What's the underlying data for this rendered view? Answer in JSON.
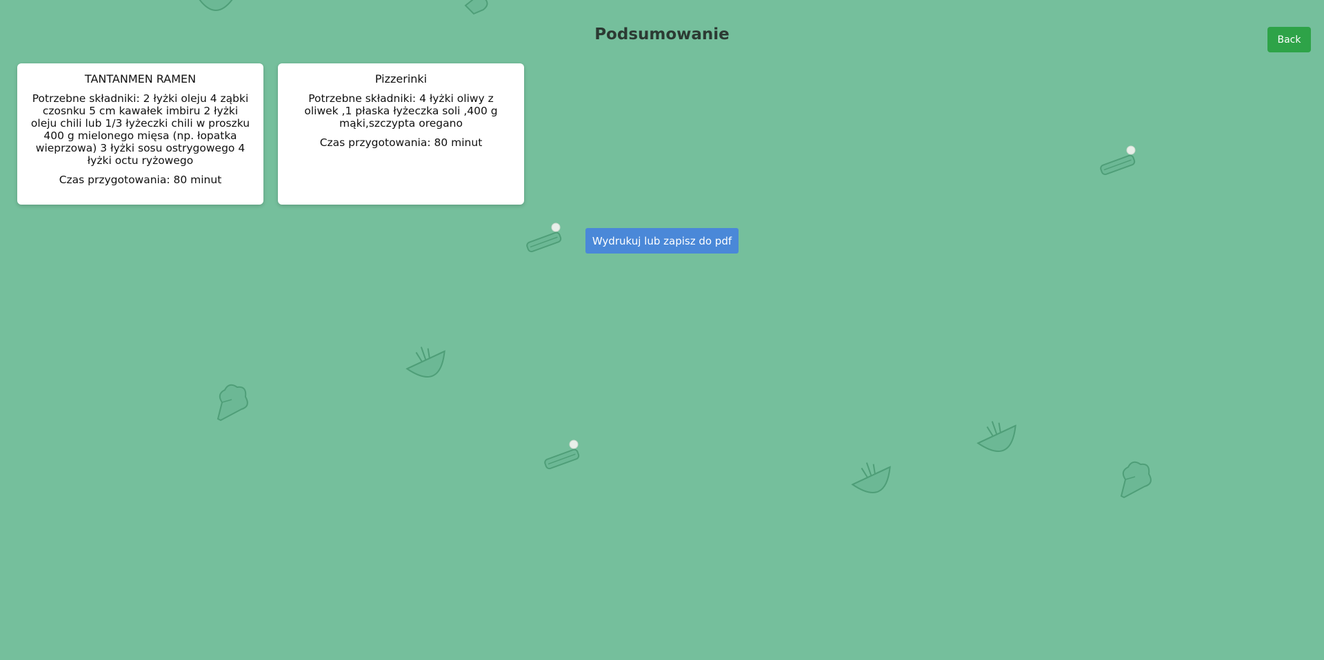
{
  "header": {
    "title": "Podsumowanie",
    "back_label": "Back"
  },
  "recipes": [
    {
      "name": "TANTANMEN RAMEN",
      "ingredients": "Potrzebne składniki: 2 łyżki oleju 4 ząbki czosnku 5 cm kawałek imbiru 2 łyżki oleju chili lub 1/3 łyżeczki chili w proszku 400 g mielonego mięsa (np. łopatka wieprzowa) 3 łyżki sosu ostrygowego 4 łyżki octu ryżowego",
      "time": "Czas przygotowania: 80 minut"
    },
    {
      "name": "Pizzerinki",
      "ingredients": "Potrzebne składniki: 4 łyżki oliwy z oliwek ,1 płaska łyżeczka soli ,400 g mąki,szczypta oregano",
      "time": "Czas przygotowania: 80 minut"
    }
  ],
  "actions": {
    "print_label": "Wydrukuj lub zapisz do pdf"
  },
  "colors": {
    "background": "#75bf9c",
    "back_button": "#2ea348",
    "print_button": "#4a88d8",
    "decor_stroke": "#4f9e78"
  },
  "decorations": [
    "salad-bowl-icon",
    "broccoli-icon",
    "sandwich-icon"
  ]
}
